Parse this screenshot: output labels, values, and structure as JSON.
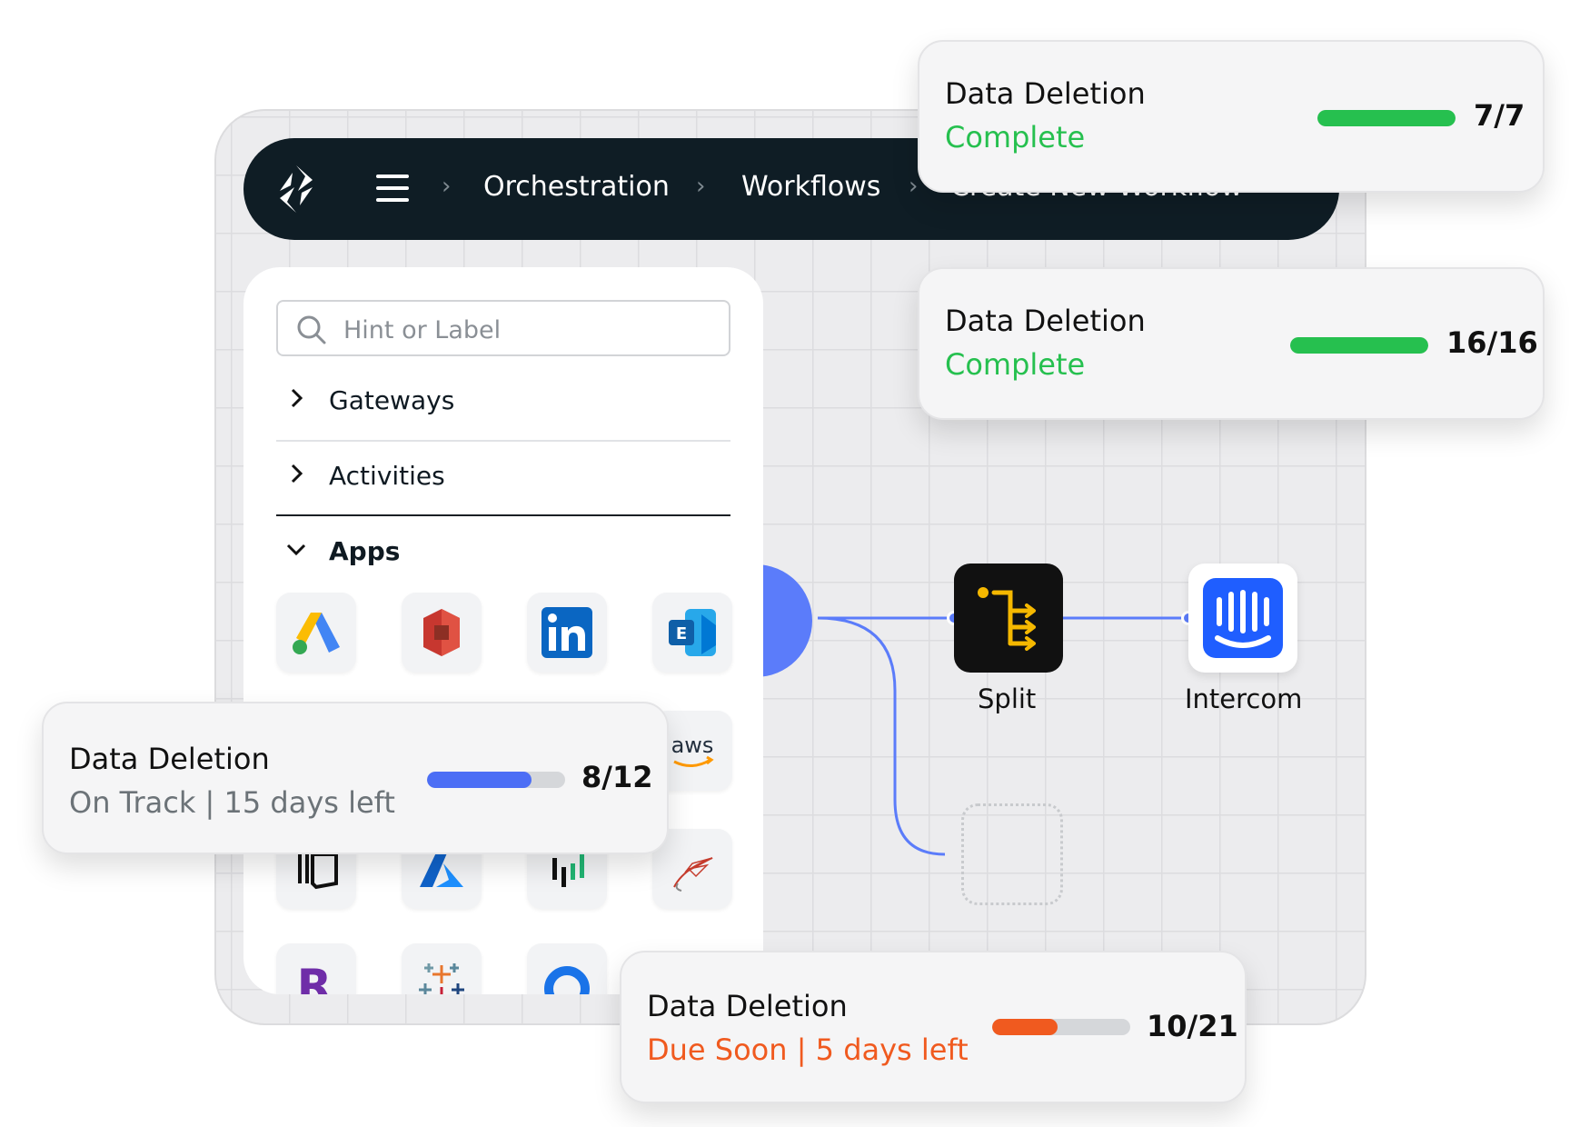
{
  "navbar": {
    "breadcrumbs": [
      "Orchestration",
      "Workflows",
      "Create New Workflow"
    ]
  },
  "sidebar": {
    "search_placeholder": "Hint or Label",
    "categories": [
      {
        "label": "Gateways",
        "expanded": false
      },
      {
        "label": "Activities",
        "expanded": false
      },
      {
        "label": "Apps",
        "expanded": true
      }
    ],
    "apps": [
      "google-ads-icon",
      "aws-s3-icon",
      "linkedin-icon",
      "exchange-icon",
      "aws-icon",
      "stack-icon",
      "azure-icon",
      "chart-bars-icon",
      "sql-server-icon",
      "r-icon",
      "tableau-icon",
      "circle-app-icon"
    ],
    "aws_text": "aws"
  },
  "workflow": {
    "nodes": [
      {
        "label": "Split",
        "icon": "split-icon"
      },
      {
        "label": "Intercom",
        "icon": "intercom-icon"
      }
    ]
  },
  "cards": [
    {
      "title": "Data Deletion",
      "status": "Complete",
      "count": "7/7",
      "progress": 1.0,
      "color": "#26c04f"
    },
    {
      "title": "Data Deletion",
      "status": "Complete",
      "count": "16/16",
      "progress": 1.0,
      "color": "#26c04f"
    },
    {
      "title": "Data Deletion",
      "status": "On Track | 15 days left",
      "count": "8/12",
      "progress": 0.7576,
      "color": "#4c6ef5"
    },
    {
      "title": "Data Deletion",
      "status": "Due Soon | 5 days left",
      "count": "10/21",
      "progress": 0.4762,
      "color": "#f05a1f"
    }
  ],
  "colors": {
    "navbar": "#0f1d25",
    "accent_blue": "#5b7cfa",
    "complete_green": "#26c04f",
    "track_gray": "#6c7378",
    "due_orange": "#f05a1f"
  }
}
